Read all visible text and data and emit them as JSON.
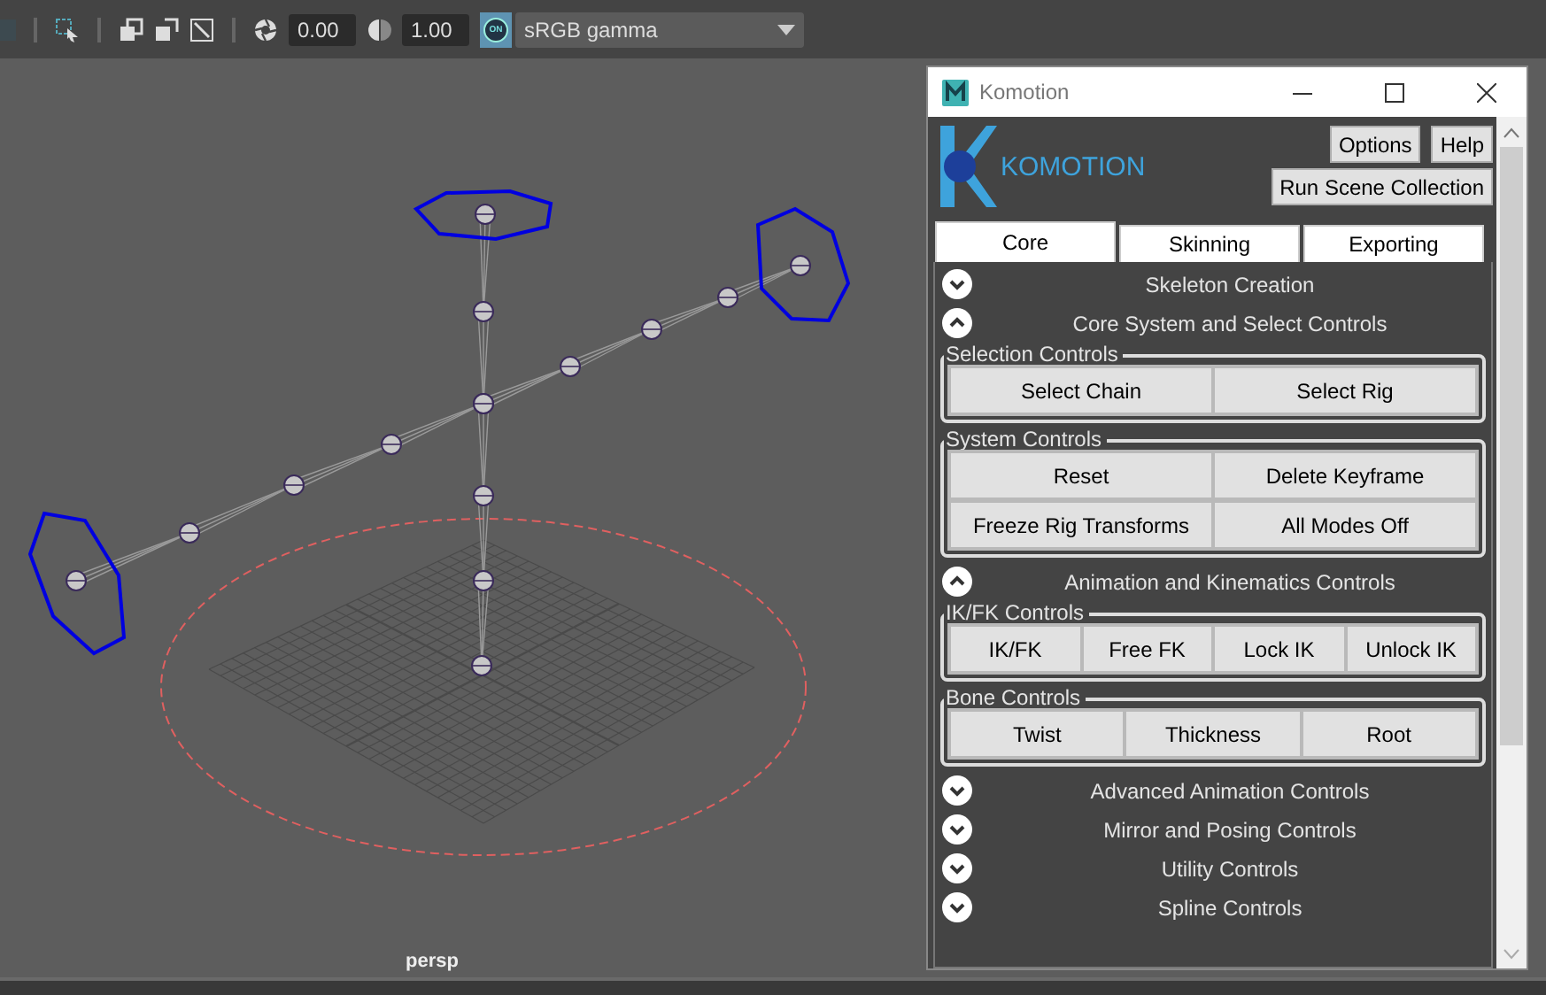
{
  "toolbar": {
    "exposure": "0.00",
    "gamma": "1.00",
    "color_management_badge": "ON",
    "view_transform": "sRGB gamma"
  },
  "viewport": {
    "camera_label": "persp"
  },
  "plugin_window": {
    "title": "Komotion",
    "logo_text": "KOMOTION",
    "header_buttons": [
      "Options",
      "Help"
    ],
    "run_button": "Run Scene Collection",
    "tabs": [
      {
        "label": "Core",
        "selected": true
      },
      {
        "label": "Skinning",
        "selected": false
      },
      {
        "label": "Exporting",
        "selected": false
      }
    ],
    "sections": [
      {
        "title": "Skeleton Creation",
        "expanded": false
      },
      {
        "title": "Core System and Select Controls",
        "expanded": true,
        "groups": [
          {
            "title": "Selection Controls",
            "rows": [
              [
                "Select Chain",
                "Select Rig"
              ]
            ]
          },
          {
            "title": "System Controls",
            "rows": [
              [
                "Reset",
                "Delete Keyframe"
              ],
              [
                "Freeze Rig Transforms",
                "All Modes Off"
              ]
            ]
          }
        ]
      },
      {
        "title": "Animation and Kinematics Controls",
        "expanded": true,
        "groups": [
          {
            "title": "IK/FK Controls",
            "rows": [
              [
                "IK/FK",
                "Free FK",
                "Lock IK",
                "Unlock IK"
              ]
            ]
          },
          {
            "title": "Bone Controls",
            "rows": [
              [
                "Twist",
                "Thickness",
                "Root"
              ]
            ]
          }
        ]
      },
      {
        "title": "Advanced Animation Controls",
        "expanded": false
      },
      {
        "title": "Mirror and Posing Controls",
        "expanded": false
      },
      {
        "title": "Utility Controls",
        "expanded": false
      },
      {
        "title": "Spline Controls",
        "expanded": false
      }
    ]
  }
}
